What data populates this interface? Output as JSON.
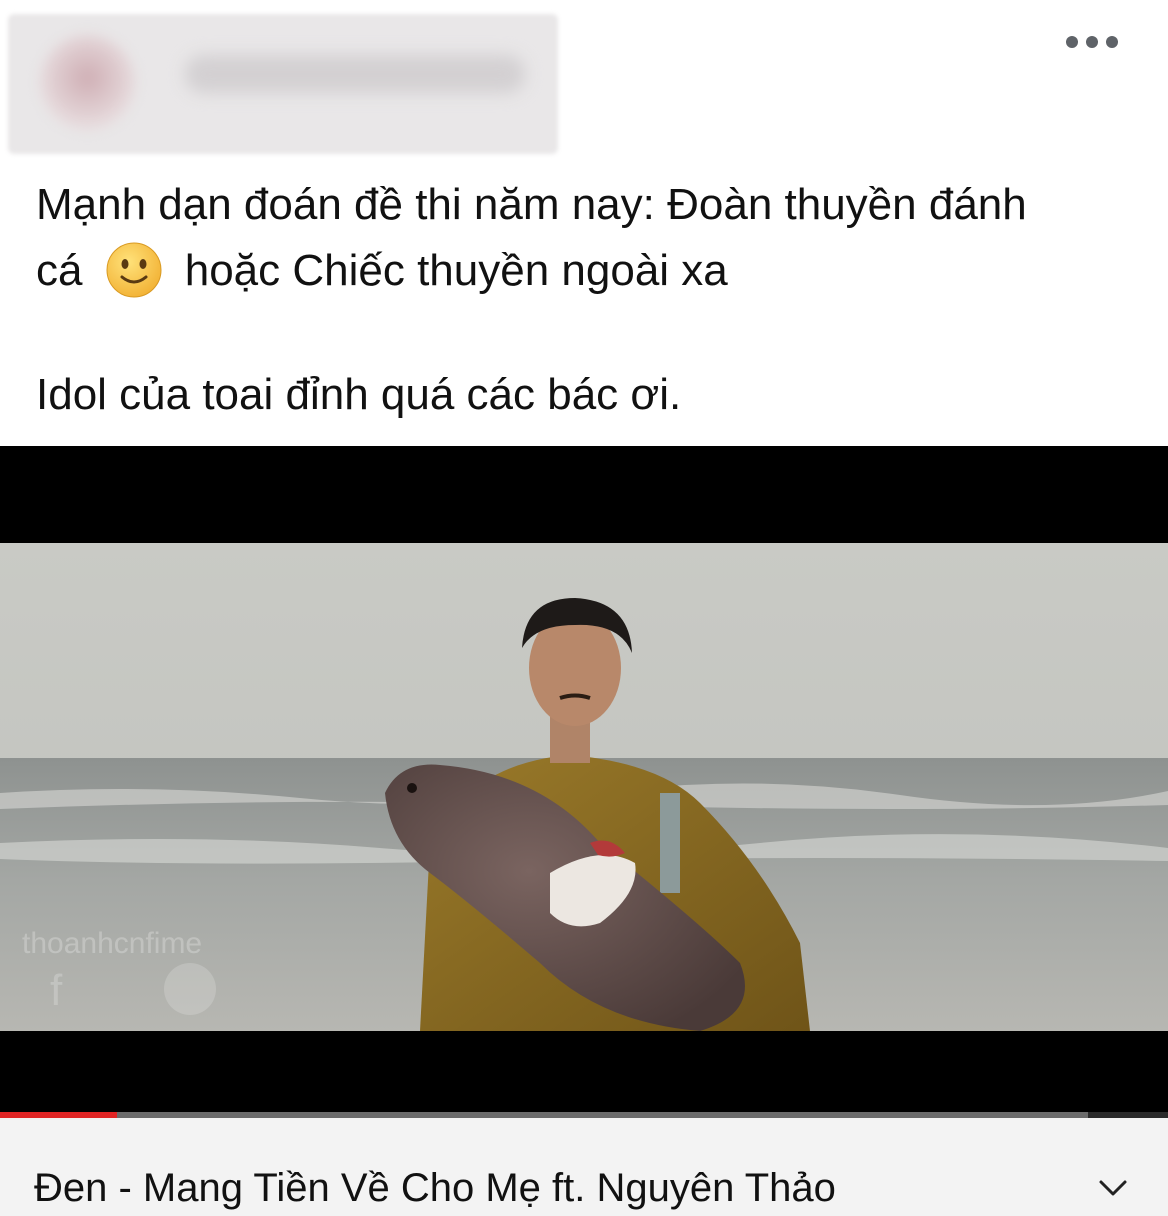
{
  "header": {
    "more_icon": "more-horizontal-icon"
  },
  "post": {
    "line1": "Mạnh dạn đoán đề thi năm nay: Đoàn thuyền đánh",
    "line2_before": "cá",
    "emoji": "slightly-smiling-face",
    "line2_after": "hoặc Chiếc thuyền ngoài xa",
    "line3": "Idol của toai đỉnh quá các bác ơi."
  },
  "video": {
    "progress_fraction": 0.1,
    "colors": {
      "progress": "#e02424",
      "accent": "#e02424"
    }
  },
  "video_info": {
    "title": "Đen - Mang Tiền Về Cho Mẹ ft. Nguyên Thảo",
    "expand_icon": "chevron-down-icon"
  }
}
